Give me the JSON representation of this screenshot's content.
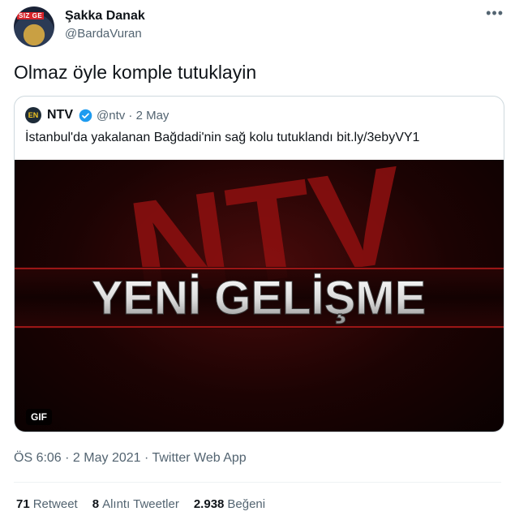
{
  "tweet": {
    "avatar_tag": "SIZ GE",
    "author_name": "Şakka Danak",
    "author_handle": "@BardaVuran",
    "more_icon": "more-dots-icon",
    "text": "Olmaz öyle komple tutuklayin",
    "timestamp": "ÖS 6:06 · 2 May 2021 · Twitter Web App"
  },
  "quoted": {
    "avatar_text": "EN",
    "author_name": "NTV",
    "verified_icon": "verified-badge-icon",
    "handle_date": "@ntv · 2 May",
    "text": "İstanbul'da yakalanan Bağdadi'nin sağ kolu tutuklandı bit.ly/3ebyVY1",
    "media": {
      "headline": "YENİ GELİŞME",
      "background_text": "NTV",
      "badge": "GIF"
    }
  },
  "stats": {
    "retweets_count": "71",
    "retweets_label": "Retweet",
    "quotes_count": "8",
    "quotes_label": "Alıntı Tweetler",
    "likes_count": "2.938",
    "likes_label": "Beğeni"
  }
}
